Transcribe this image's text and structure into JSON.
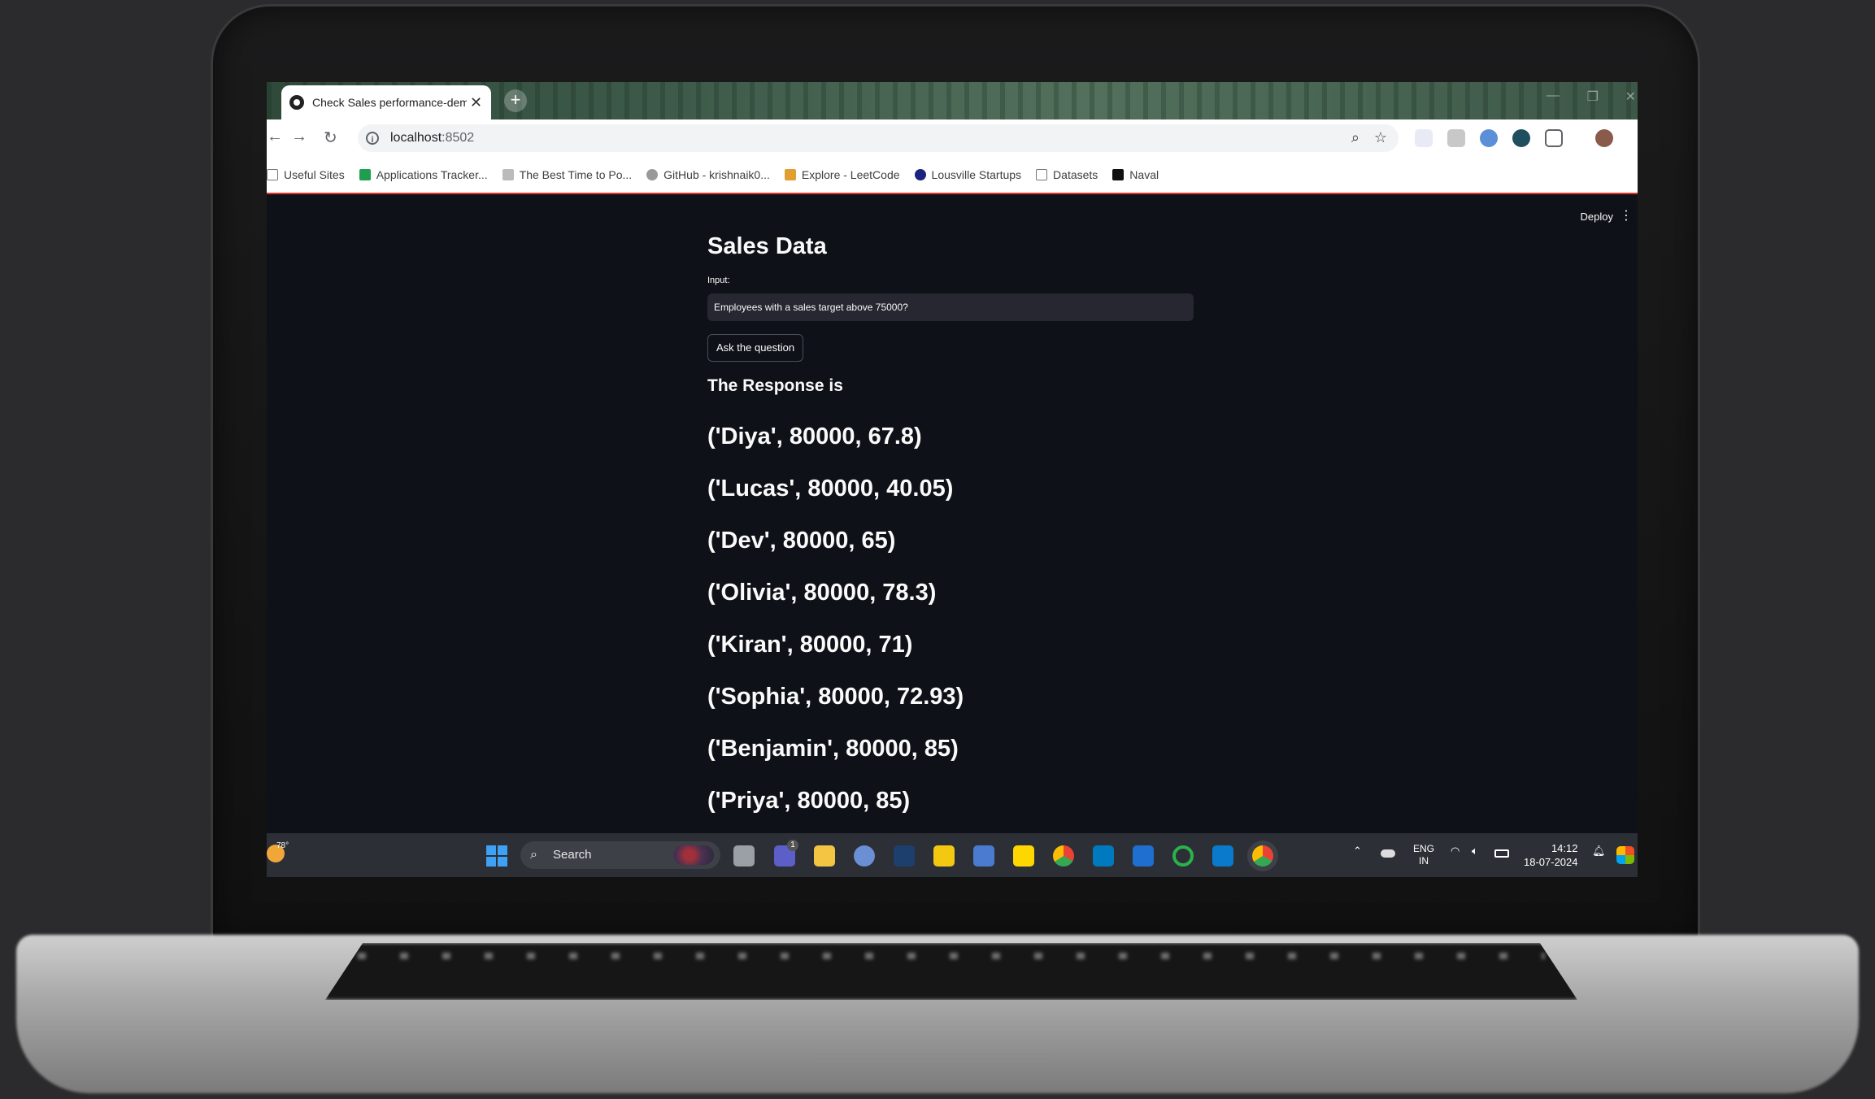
{
  "browser": {
    "tab_title": "Check Sales performance-demo",
    "url_host": "localhost",
    "url_port": ":8502",
    "bookmarks": [
      {
        "label": "Useful Sites",
        "icon": "folder-icon"
      },
      {
        "label": "Applications Tracker...",
        "icon": "sheets-icon"
      },
      {
        "label": "The Best Time to Po...",
        "icon": "stack-icon"
      },
      {
        "label": "GitHub - krishnaik0...",
        "icon": "github-icon"
      },
      {
        "label": "Explore - LeetCode",
        "icon": "leetcode-icon"
      },
      {
        "label": "Lousville Startups",
        "icon": "startup-icon"
      },
      {
        "label": "Datasets",
        "icon": "folder-icon"
      },
      {
        "label": "Naval",
        "icon": "naval-icon"
      }
    ]
  },
  "app": {
    "deploy_label": "Deploy",
    "title": "Sales Data",
    "input_label": "Input:",
    "input_value": "Employees with a sales target above 75000?",
    "ask_button": "Ask the question",
    "response_heading": "The Response is",
    "rows": [
      "('Diya', 80000, 67.8)",
      "('Lucas', 80000, 40.05)",
      "('Dev', 80000, 65)",
      "('Olivia', 80000, 78.3)",
      "('Kiran', 80000, 71)",
      "('Sophia', 80000, 72.93)",
      "('Benjamin', 80000, 85)",
      "('Priya', 80000, 85)"
    ]
  },
  "taskbar": {
    "weather_temp": "78°",
    "search_label": "Search",
    "lang_top": "ENG",
    "lang_bottom": "IN",
    "time": "14:12",
    "date": "18-07-2024",
    "badge_count": "1"
  },
  "colors": {
    "app_background": "#0e1117",
    "text": "#fafafa",
    "input_background": "#262730",
    "bookmark_border": "#d9382f"
  }
}
